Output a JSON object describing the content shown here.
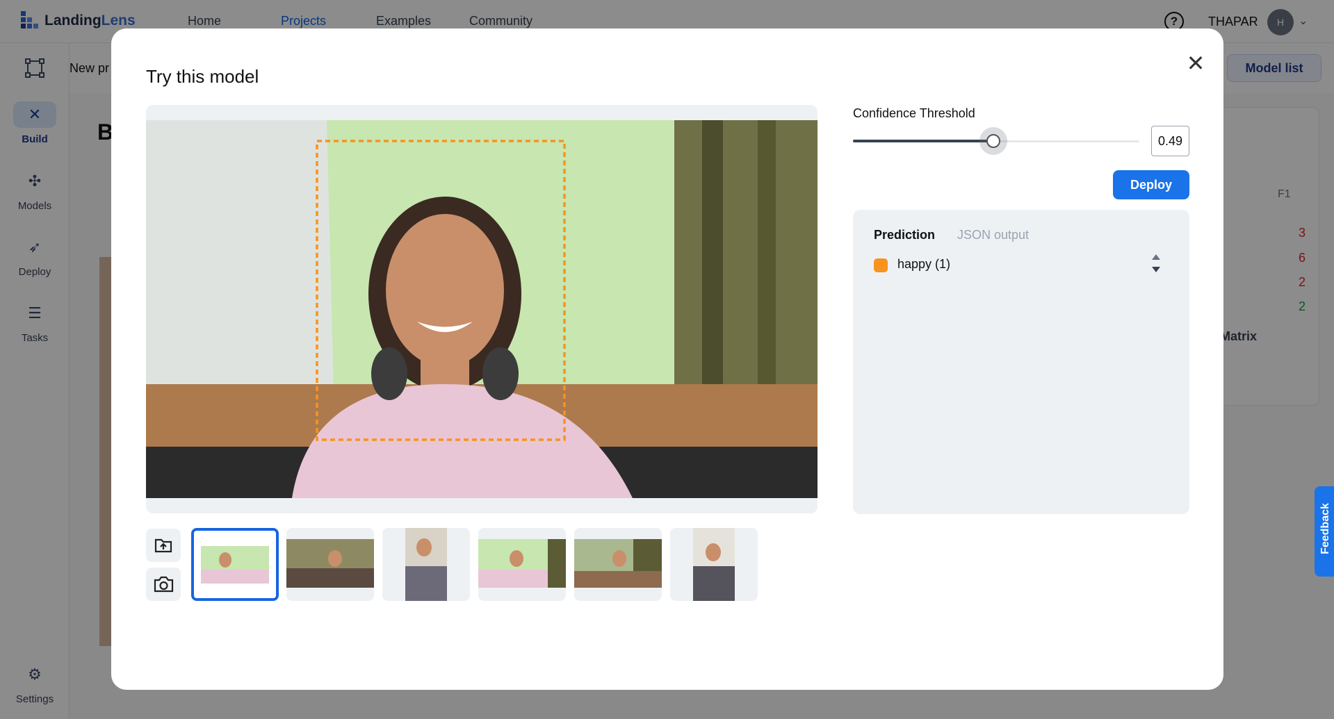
{
  "app": {
    "logo_text_main": "Landing",
    "logo_text_accent": "Lens",
    "nav": [
      "Home",
      "Projects",
      "Examples",
      "Community"
    ],
    "active_nav": "Projects",
    "user_name": "THAPAR",
    "avatar_initial": "H"
  },
  "sidebar": {
    "items": [
      {
        "label": "Build",
        "icon": "build-icon",
        "active": true
      },
      {
        "label": "Models",
        "icon": "models-icon",
        "active": false
      },
      {
        "label": "Deploy",
        "icon": "rocket-icon",
        "active": false
      },
      {
        "label": "Tasks",
        "icon": "tasks-icon",
        "active": false
      },
      {
        "label": "Settings",
        "icon": "gear-icon",
        "active": false
      }
    ]
  },
  "background": {
    "project_name": "New pr",
    "big_letter": "B",
    "model_list_label": "Model list",
    "metric_label": "F1",
    "metric_values": [
      "3",
      "6",
      "2",
      "2"
    ],
    "metric_colors": [
      "#dc2626",
      "#dc2626",
      "#dc2626",
      "#16a34a"
    ],
    "matrix_label": "Matrix",
    "feedback_label": "Feedback"
  },
  "modal": {
    "title": "Try this model",
    "confidence": {
      "label": "Confidence Threshold",
      "value": "0.49",
      "fraction": 0.49
    },
    "deploy_label": "Deploy",
    "tabs": [
      "Prediction",
      "JSON output"
    ],
    "active_tab": "Prediction",
    "predictions": [
      {
        "label": "happy (1)",
        "color": "#f7931e"
      }
    ],
    "bbox_color": "#f7931e",
    "thumbnail_count": 6,
    "selected_thumbnail": 0
  }
}
